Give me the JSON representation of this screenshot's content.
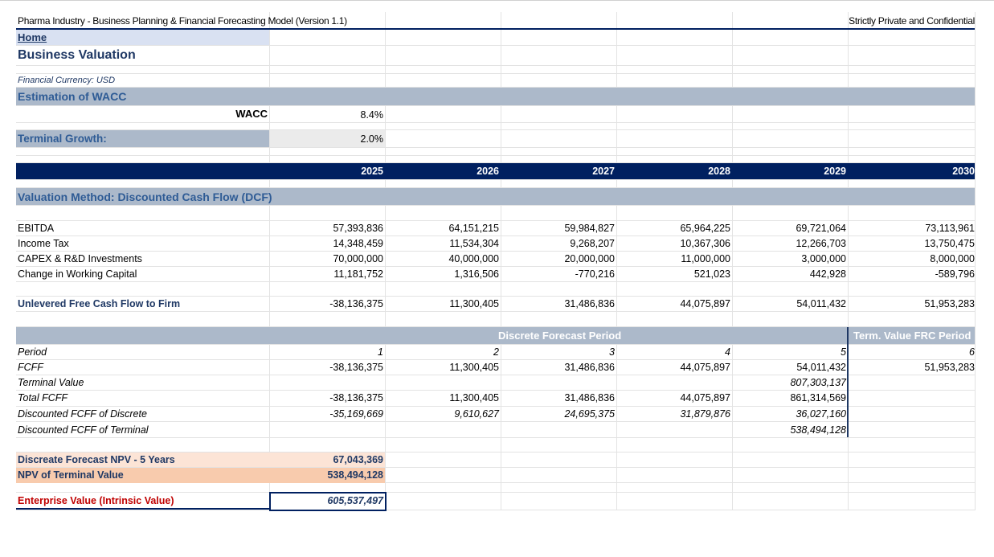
{
  "header": {
    "model_title": "Pharma Industry - Business Planning & Financial Forecasting Model (Version 1.1)",
    "confidential": "Strictly Private and Confidential",
    "home_link": "Home",
    "page_title": "Business Valuation",
    "currency_note": "Financial Currency: USD"
  },
  "wacc_section": {
    "heading": "Estimation of WACC",
    "wacc_label": "WACC",
    "wacc_value": "8.4%",
    "growth_label": "Terminal Growth:",
    "growth_value": "2.0%"
  },
  "years": [
    "2025",
    "2026",
    "2027",
    "2028",
    "2029",
    "2030"
  ],
  "dcf": {
    "heading": "Valuation Method: Discounted Cash Flow (DCF)",
    "rows": [
      {
        "label": "EBITDA",
        "values": [
          "57,393,836",
          "64,151,215",
          "59,984,827",
          "65,964,225",
          "69,721,064",
          "73,113,961"
        ]
      },
      {
        "label": "Income Tax",
        "values": [
          "14,348,459",
          "11,534,304",
          "9,268,207",
          "10,367,306",
          "12,266,703",
          "13,750,475"
        ]
      },
      {
        "label": "CAPEX & R&D Investments",
        "values": [
          "70,000,000",
          "40,000,000",
          "20,000,000",
          "11,000,000",
          "3,000,000",
          "8,000,000"
        ]
      },
      {
        "label": "Change in Working Capital",
        "values": [
          "11,181,752",
          "1,316,506",
          "-770,216",
          "521,023",
          "442,928",
          "-589,796"
        ]
      }
    ],
    "ufcf": {
      "label": "Unlevered Free Cash Flow to Firm",
      "values": [
        "-38,136,375",
        "11,300,405",
        "31,486,836",
        "44,075,897",
        "54,011,432",
        "51,953,283"
      ]
    }
  },
  "forecast": {
    "discrete_title": "Discrete Forecast Period",
    "terminal_title": "Term. Value FRC Period",
    "rows": [
      {
        "label": "Period",
        "values": [
          "1",
          "2",
          "3",
          "4",
          "5",
          "6"
        ]
      },
      {
        "label": "FCFF",
        "values": [
          "-38,136,375",
          "11,300,405",
          "31,486,836",
          "44,075,897",
          "54,011,432",
          "51,953,283"
        ]
      },
      {
        "label": "Terminal Value",
        "values": [
          "",
          "",
          "",
          "",
          "807,303,137",
          ""
        ]
      },
      {
        "label": "Total FCFF",
        "values": [
          "-38,136,375",
          "11,300,405",
          "31,486,836",
          "44,075,897",
          "861,314,569",
          ""
        ]
      },
      {
        "label": "Discounted FCFF of Discrete",
        "values": [
          "-35,169,669",
          "9,610,627",
          "24,695,375",
          "31,879,876",
          "36,027,160",
          ""
        ]
      },
      {
        "label": "Discounted FCFF of Terminal",
        "values": [
          "",
          "",
          "",
          "",
          "538,494,128",
          ""
        ]
      }
    ]
  },
  "summary": {
    "npv_discrete_label": "Discreate Forecast NPV - 5 Years",
    "npv_discrete_value": "67,043,369",
    "npv_terminal_label": "NPV of Terminal Value",
    "npv_terminal_value": "538,494,128",
    "ev_label": "Enterprise Value (Intrinsic Value)",
    "ev_value": "605,537,497"
  },
  "colors": {
    "navy": "#002060",
    "section_band": "#acb9ca",
    "npv_discrete_fill": "#fce4d6",
    "npv_terminal_fill": "#f8cbad",
    "ev_label_color": "#c00000"
  }
}
